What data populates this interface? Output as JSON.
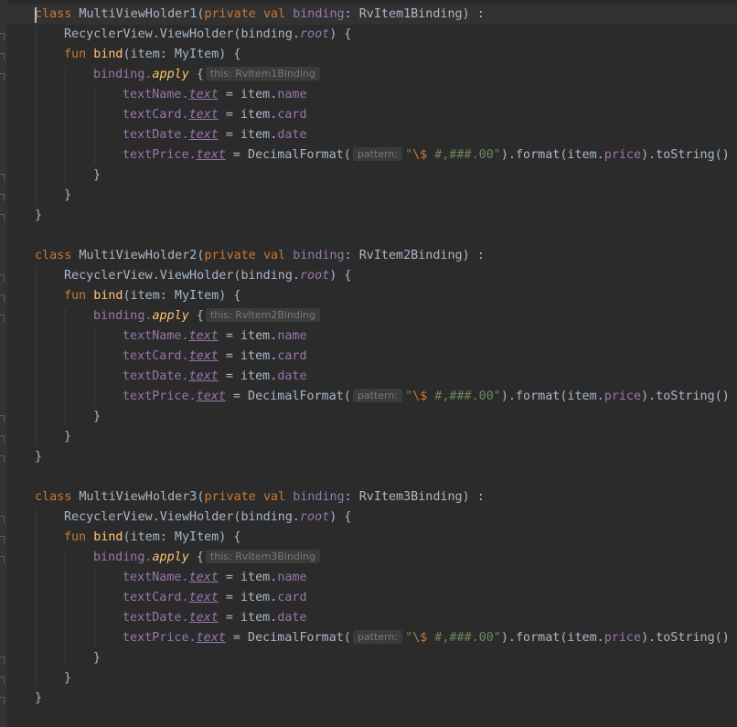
{
  "editor": {
    "blocks": [
      {
        "decl_keyword": "class",
        "class_name": "MultiViewHolder1",
        "open_paren": "(",
        "mod_private": "private",
        "mod_val": "val",
        "param_name": "binding",
        "colon_type": ": RvItem1Binding) :",
        "super_call": "RecyclerView.ViewHolder(binding.",
        "root_prop": "root",
        "super_end": ") {",
        "fun_kw": "fun",
        "fun_name": "bind",
        "fun_params": "(item: MyItem) {",
        "apply_recv": "binding.",
        "apply_fn": "apply",
        "apply_brace": "{",
        "apply_hint": "this: RvItem1Binding",
        "assignments": [
          {
            "view": "textName.",
            "prop": "text",
            "rhs_pre": " = item.",
            "field": "name"
          },
          {
            "view": "textCard.",
            "prop": "text",
            "rhs_pre": " = item.",
            "field": "card"
          },
          {
            "view": "textDate.",
            "prop": "text",
            "rhs_pre": " = item.",
            "field": "date"
          }
        ],
        "price": {
          "view": "textPrice.",
          "prop": "text",
          "rhs_pre": " = DecimalFormat(",
          "hint": "pattern:",
          "str_open": "\"",
          "esc": "\\$",
          "str_rest": " #,###.00\"",
          "call_mid": ").format(item.",
          "field": "price",
          "call_end": ").toString()"
        },
        "close_apply": "}",
        "close_fun": "}",
        "close_class": "}"
      },
      {
        "decl_keyword": "class",
        "class_name": "MultiViewHolder2",
        "open_paren": "(",
        "mod_private": "private",
        "mod_val": "val",
        "param_name": "binding",
        "colon_type": ": RvItem2Binding) :",
        "super_call": "RecyclerView.ViewHolder(binding.",
        "root_prop": "root",
        "super_end": ") {",
        "fun_kw": "fun",
        "fun_name": "bind",
        "fun_params": "(item: MyItem) {",
        "apply_recv": "binding.",
        "apply_fn": "apply",
        "apply_brace": "{",
        "apply_hint": "this: RvItem2Binding",
        "assignments": [
          {
            "view": "textName.",
            "prop": "text",
            "rhs_pre": " = item.",
            "field": "name"
          },
          {
            "view": "textCard.",
            "prop": "text",
            "rhs_pre": " = item.",
            "field": "card"
          },
          {
            "view": "textDate.",
            "prop": "text",
            "rhs_pre": " = item.",
            "field": "date"
          }
        ],
        "price": {
          "view": "textPrice.",
          "prop": "text",
          "rhs_pre": " = DecimalFormat(",
          "hint": "pattern:",
          "str_open": "\"",
          "esc": "\\$",
          "str_rest": " #,###.00\"",
          "call_mid": ").format(item.",
          "field": "price",
          "call_end": ").toString()"
        },
        "close_apply": "}",
        "close_fun": "}",
        "close_class": "}"
      },
      {
        "decl_keyword": "class",
        "class_name": "MultiViewHolder3",
        "open_paren": "(",
        "mod_private": "private",
        "mod_val": "val",
        "param_name": "binding",
        "colon_type": ": RvItem3Binding) :",
        "super_call": "RecyclerView.ViewHolder(binding.",
        "root_prop": "root",
        "super_end": ") {",
        "fun_kw": "fun",
        "fun_name": "bind",
        "fun_params": "(item: MyItem) {",
        "apply_recv": "binding.",
        "apply_fn": "apply",
        "apply_brace": "{",
        "apply_hint": "this: RvItem3Binding",
        "assignments": [
          {
            "view": "textName.",
            "prop": "text",
            "rhs_pre": " = item.",
            "field": "name"
          },
          {
            "view": "textCard.",
            "prop": "text",
            "rhs_pre": " = item.",
            "field": "card"
          },
          {
            "view": "textDate.",
            "prop": "text",
            "rhs_pre": " = item.",
            "field": "date"
          }
        ],
        "price": {
          "view": "textPrice.",
          "prop": "text",
          "rhs_pre": " = DecimalFormat(",
          "hint": "pattern:",
          "str_open": "\"",
          "esc": "\\$",
          "str_rest": " #,###.00\"",
          "call_mid": ").format(item.",
          "field": "price",
          "call_end": ").toString()"
        },
        "close_apply": "}",
        "close_fun": "}",
        "close_class": "}"
      }
    ]
  },
  "colors": {
    "background": "#2b2b2b",
    "keyword": "#cc7832",
    "function": "#ffc66d",
    "property": "#9876aa",
    "string": "#6a8759",
    "text": "#a9b7c6"
  }
}
